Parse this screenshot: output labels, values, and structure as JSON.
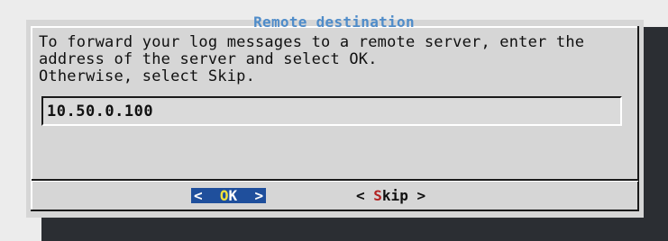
{
  "dialog": {
    "title": "Remote destination",
    "message": "To forward your log messages to a remote server, enter the\naddress of the server and select OK.\nOtherwise, select Skip.",
    "input_value": "10.50.0.100"
  },
  "buttons": {
    "ok": {
      "left": "<",
      "hotkey": "O",
      "rest": "K",
      "right": ">"
    },
    "skip": {
      "left": "<",
      "hotkey": "S",
      "rest": "kip",
      "right": ">"
    }
  },
  "colors": {
    "dialog_bg": "#d6d6d6",
    "title": "#4f8cc9",
    "ok_button_bg": "#1f4f9c",
    "ok_hotkey": "#f2e23a",
    "skip_hotkey": "#b22222",
    "shadow": "#2b2e33"
  }
}
